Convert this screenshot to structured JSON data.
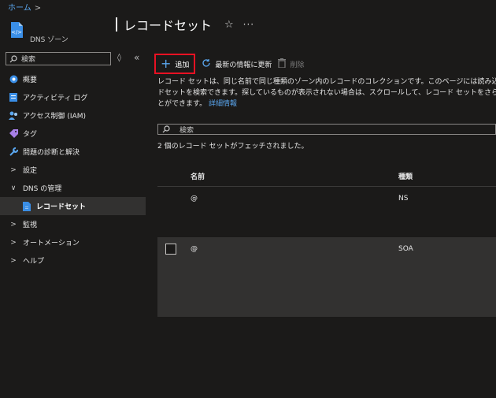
{
  "breadcrumb": {
    "home": "ホーム",
    "sep": ">"
  },
  "resource": {
    "type_label": "DNS ゾーン",
    "icon": "dns-zone-icon"
  },
  "page": {
    "title": "レコードセット",
    "favorite_icon": "star-icon",
    "more_icon": "ellipsis-icon"
  },
  "sidebar": {
    "search_placeholder": "検索",
    "collapse_glyph": "«",
    "expand_glyph": "◊",
    "items": [
      {
        "label": "概要",
        "icon": "overview-icon"
      },
      {
        "label": "アクティビティ ログ",
        "icon": "activity-log-icon"
      },
      {
        "label": "アクセス制御 (IAM)",
        "icon": "iam-icon"
      },
      {
        "label": "タグ",
        "icon": "tag-icon"
      },
      {
        "label": "問題の診断と解決",
        "icon": "wrench-icon"
      },
      {
        "label": "設定",
        "icon": "chevron-right-icon"
      },
      {
        "label": "DNS の管理",
        "icon": "chevron-down-icon"
      },
      {
        "label": "レコードセット",
        "icon": "recordset-icon"
      },
      {
        "label": "監視",
        "icon": "chevron-right-icon"
      },
      {
        "label": "オートメーション",
        "icon": "chevron-right-icon"
      },
      {
        "label": "ヘルプ",
        "icon": "chevron-right-icon"
      }
    ]
  },
  "toolbar": {
    "add_label": "追加",
    "refresh_label": "最新の情報に更新",
    "delete_label": "削除"
  },
  "description": {
    "line1": "レコード セットは、同じ名前で同じ種類のゾーン内のレコードのコレクションです。このページには読み込",
    "line2": "ドセットを検索できます。探しているものが表示されない場合は、スクロールして、レコード セットをさらに",
    "line3": "とができます。",
    "link": "詳細情報"
  },
  "search": {
    "placeholder": "検索"
  },
  "count_text": "2 個のレコード セットがフェッチされました。",
  "table": {
    "columns": [
      "名前",
      "種類"
    ],
    "rows": [
      {
        "name": "@",
        "type": "NS"
      },
      {
        "name": "@",
        "type": "SOA"
      }
    ]
  },
  "colors": {
    "accent": "#5aa6ee",
    "highlight_border": "#e81123",
    "background": "#1b1a19",
    "selected_row": "#323130"
  }
}
